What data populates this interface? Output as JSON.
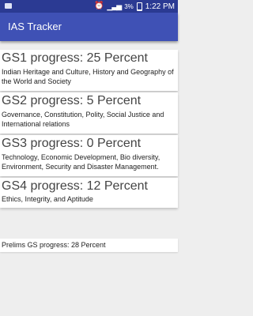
{
  "status_bar": {
    "battery_percent": "3%",
    "time": "1:22 PM",
    "icons": [
      "notification-icon",
      "alarm-icon",
      "signal-icon",
      "battery-icon"
    ]
  },
  "app_bar": {
    "title": "IAS Tracker"
  },
  "cards": [
    {
      "heading": "GS1 progress: 25 Percent",
      "desc": " Indian Heritage and Culture, History and Geography of the World and Society"
    },
    {
      "heading": "GS2 progress: 5 Percent",
      "desc": "Governance, Constitution, Polity, Social Justice and International relations"
    },
    {
      "heading": "GS3 progress: 0 Percent",
      "desc": "Technology, Economic Development, Bio diversity, Environment, Security and Disaster Management."
    },
    {
      "heading": "GS4 progress: 12 Percent",
      "desc": "Ethics, Integrity, and Aptitude"
    }
  ],
  "prelims": {
    "text": "Prelims GS progress: 28 Percent"
  },
  "colors": {
    "primary": "#3f51b5",
    "primary_dark": "#2b3a93",
    "background": "#eeeeee"
  }
}
